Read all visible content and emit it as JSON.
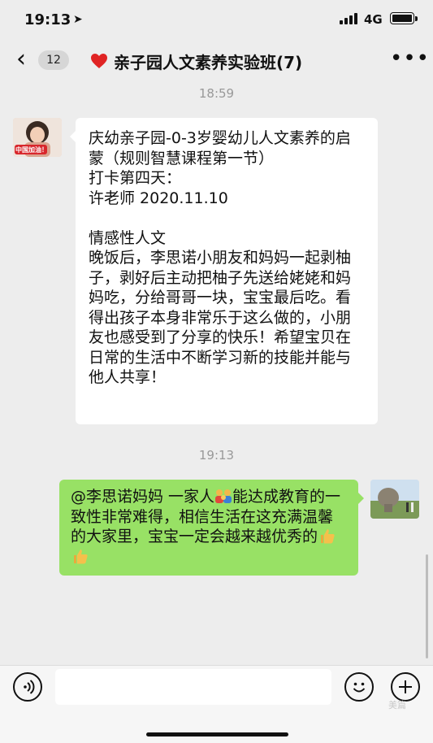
{
  "status_bar": {
    "time": "19:13",
    "network": "4G"
  },
  "nav": {
    "back_icon": "chevron-left-icon",
    "unread_count": "12",
    "title_icon": "red-heart-icon",
    "title": "亲子园人文素养实验班(7)",
    "more_icon": "more-dots-icon"
  },
  "messages": {
    "timestamp_1": "18:59",
    "incoming_text": "庆幼亲子园-0-3岁婴幼儿人文素养的启蒙（规则智慧课程第一节）\n打卡第四天：\n许老师 2020.11.10\n\n情感性人文\n晚饭后，李思诺小朋友和妈妈一起剥柚子，剥好后主动把柚子先送给姥姥和妈妈吃，分给哥哥一块，宝宝最后吃。看得出孩子本身非常乐于这么做的，小朋友也感受到了分享的快乐！希望宝贝在日常的生活中不断学习新的技能并能与他人共享！",
    "incoming_avatar_badge": "中国加油！",
    "timestamp_2": "19:13",
    "outgoing_part_1": "@李思诺妈妈 一家人",
    "outgoing_part_2": "能达成教育的一致性非常难得，相信生活在这充满温馨的大家里，宝宝一定会越来越优秀的"
  },
  "input_bar": {
    "voice_icon": "voice-icon",
    "emoji_icon": "smiley-icon",
    "plus_icon": "plus-icon",
    "watermark": "美篇"
  },
  "colors": {
    "background": "#ededed",
    "outgoing_bubble": "#98e165",
    "incoming_bubble": "#ffffff"
  }
}
